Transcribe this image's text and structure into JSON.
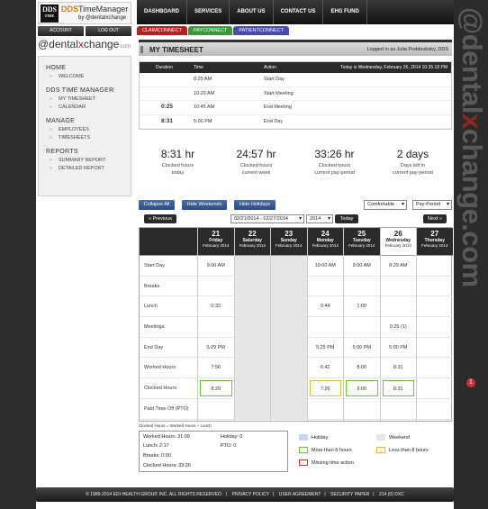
{
  "brand": {
    "logo_dds": "DDS",
    "logo_time": "TIME",
    "app_title_part1": "DDS",
    "app_title_part2": "TimeManager",
    "by": "by @dentalxchange",
    "brand_text_pre": "@dental",
    "brand_text_x": "x",
    "brand_text_post": "change",
    "brand_suffix": ".com"
  },
  "top_nav": [
    "DASHBOARD",
    "SERVICES",
    "ABOUT US",
    "CONTACT US",
    "EHG FUND"
  ],
  "account": {
    "account_label": "ACCOUNT",
    "logout_label": "LOG OUT"
  },
  "connect_tabs": [
    {
      "label": "CLAIMCONNECT",
      "color": "#b22222"
    },
    {
      "label": "PAYCONNECT",
      "color": "#3a9a3a"
    },
    {
      "label": "PATIENTCONNECT",
      "color": "#4a4aa8"
    }
  ],
  "side_menu": {
    "home_heading": "HOME",
    "home_items": [
      "WELCOME"
    ],
    "ddstm_heading": "DDS TIME MANAGER",
    "ddstm_items": [
      "MY TIMESHEET",
      "CALENDAR"
    ],
    "manage_heading": "MANAGE",
    "manage_items": [
      "EMPLOYEES",
      "TIMESHEETS"
    ],
    "reports_heading": "REPORTS",
    "reports_items": [
      "SUMMARY REPORT",
      "DETAILED REPORT"
    ]
  },
  "timesheet": {
    "title": "MY TIMESHEET",
    "logged_in": "Logged in as Julia Poddoubsky, DDS"
  },
  "log": {
    "headers": {
      "duration": "Duration",
      "time": "Time",
      "action": "Action",
      "today": "Today is Wednesday, February 26, 2014 10:35:18 PM"
    },
    "rows": [
      {
        "duration": "",
        "time": "8:29 AM",
        "action": "Start Day"
      },
      {
        "duration": "",
        "time": "10:20 AM",
        "action": "Start Meeting"
      },
      {
        "duration": "0:25",
        "time": "10:45 AM",
        "action": "End Meeting"
      },
      {
        "duration": "8:31",
        "time": "5:00 PM",
        "action": "End Day"
      }
    ]
  },
  "stats": [
    {
      "value": "8:31 hr",
      "line1": "Clocked hours",
      "line2": "today"
    },
    {
      "value": "24:57 hr",
      "line1": "Clocked hours",
      "line2": "current week"
    },
    {
      "value": "33:26 hr",
      "line1": "Clocked hours",
      "line2": "current pay-period"
    },
    {
      "value": "2 days",
      "line1": "Days left in",
      "line2": "current pay-period"
    }
  ],
  "toolbar": {
    "collapse_all": "Collapse All",
    "hide_weekends": "Hide Weekends",
    "hide_holidays": "Hide Holidays",
    "density": "Comfortable",
    "period": "Pay-Period"
  },
  "pager": {
    "previous": "« Previous",
    "range": "02/21/2014 - 02/27/2014",
    "year": "2014",
    "today": "Today",
    "next": "Next »"
  },
  "days": [
    {
      "num": "21",
      "name": "Friday",
      "month": "February 2014",
      "weekend": false,
      "today": false
    },
    {
      "num": "22",
      "name": "Saturday",
      "month": "February 2014",
      "weekend": true,
      "today": false
    },
    {
      "num": "23",
      "name": "Sunday",
      "month": "February 2014",
      "weekend": true,
      "today": false
    },
    {
      "num": "24",
      "name": "Monday",
      "month": "February 2014",
      "weekend": false,
      "today": false
    },
    {
      "num": "25",
      "name": "Tuesday",
      "month": "February 2014",
      "weekend": false,
      "today": false
    },
    {
      "num": "26",
      "name": "Wednesday",
      "month": "February 2014",
      "weekend": false,
      "today": true
    },
    {
      "num": "27",
      "name": "Thursday",
      "month": "February 2014",
      "weekend": false,
      "today": false
    }
  ],
  "row_labels": [
    "Start Day",
    "Breaks",
    "Lunch",
    "Meetings",
    "End Day",
    "Worked Hours",
    "Clocked Hours",
    "Paid Time Off (PTO)"
  ],
  "grid_values": [
    [
      "9:00 AM",
      "",
      "0:33",
      "",
      "5:29 PM",
      "7:56",
      "8:29",
      ""
    ],
    [
      "",
      "",
      "",
      "",
      "",
      "",
      "",
      ""
    ],
    [
      "",
      "",
      "",
      "",
      "",
      "",
      "",
      ""
    ],
    [
      "10:00 AM",
      "",
      "0:44",
      "",
      "5:25 PM",
      "6:42",
      "7:26",
      ""
    ],
    [
      "9:00 AM",
      "",
      "1:00",
      "",
      "5:00 PM",
      "8:00",
      "9:00",
      ""
    ],
    [
      "8:29 AM",
      "",
      "",
      "0:25 (1)",
      "5:00 PM",
      "8:31",
      "8:31",
      ""
    ],
    [
      "",
      "",
      "",
      "",
      "",
      "",
      "",
      ""
    ]
  ],
  "clocked_box": [
    "green",
    "",
    "",
    "yellow",
    "green",
    "green",
    ""
  ],
  "formula": "Clocked Hours = Worked Hours + Lunch",
  "summary": {
    "worked": "Worked Hours: 31:09",
    "lunch": "Lunch: 2:17",
    "breaks": "Breaks: 0:00",
    "clocked": "Clocked Hours: 33:26",
    "holiday": "Holiday: 0",
    "pto": "PTO: 0"
  },
  "legend": {
    "holiday": "Holiday",
    "weekend": "Weekend",
    "more8": "More than 8 hours",
    "less8": "Less than 8 hours",
    "missing": "Missing time action",
    "colors": {
      "holiday": "#c9d7ee",
      "weekend": "#e6e6e6",
      "more8": "#6c3",
      "less8": "#eb3",
      "missing": "#c33"
    }
  },
  "footer": {
    "copyright": "© 1989-2014 EDI-HEALTH GROUP, INC. ALL RIGHTS RESERVED.",
    "privacy": "PRIVACY POLICY",
    "agreement": "USER AGREEMENT",
    "security": "SECURITY PAPER",
    "code": "214 (0) DXC"
  },
  "side_brand": {
    "pre": "@dental",
    "x": "x",
    "post": "change.com",
    "badge": "1"
  }
}
